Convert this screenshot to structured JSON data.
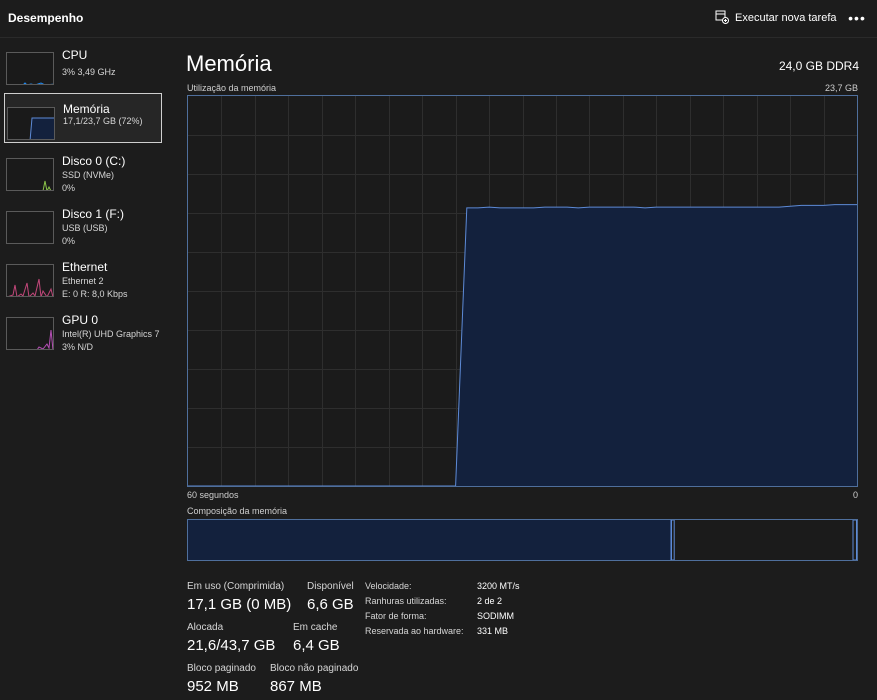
{
  "header": {
    "title": "Desempenho",
    "run_task_label": "Executar nova tarefa",
    "more_label": "•••"
  },
  "sidebar": {
    "items": [
      {
        "name": "CPU",
        "line1": "3% 3,49 GHz",
        "line2": "",
        "color": "#1e90ff",
        "selected": false
      },
      {
        "name": "Memória",
        "line1": "17,1/23,7 GB (72%)",
        "line2": "",
        "color": "#5d8ad6",
        "selected": true
      },
      {
        "name": "Disco 0 (C:)",
        "line1": "SSD (NVMe)",
        "line2": "0%",
        "color": "#8bc34a",
        "selected": false
      },
      {
        "name": "Disco 1 (F:)",
        "line1": "USB (USB)",
        "line2": "0%",
        "color": "#8bc34a",
        "selected": false
      },
      {
        "name": "Ethernet",
        "line1": "Ethernet 2",
        "line2": "E: 0 R: 8,0 Kbps",
        "color": "#c2477a",
        "selected": false
      },
      {
        "name": "GPU 0",
        "line1": "Intel(R) UHD Graphics 7",
        "line2": "3% N/D",
        "color": "#b64fb6",
        "selected": false
      }
    ]
  },
  "main": {
    "title": "Memória",
    "spec": "24,0 GB DDR4",
    "usage_label": "Utilização da memória",
    "max_label": "23,7 GB",
    "time_left": "60 segundos",
    "time_right": "0",
    "composition_label": "Composição da memória"
  },
  "usage_graph": {
    "max_gb": 23.7,
    "values_gb": [
      0,
      0,
      0,
      0,
      0,
      0,
      0,
      0,
      0,
      0,
      0,
      0,
      0,
      0,
      0,
      0,
      0,
      0,
      0,
      0,
      0,
      0,
      0,
      0,
      0,
      16.9,
      16.9,
      16.95,
      16.9,
      16.9,
      16.9,
      16.9,
      16.95,
      16.95,
      16.95,
      16.9,
      16.95,
      16.95,
      16.95,
      16.95,
      16.95,
      16.9,
      16.95,
      16.95,
      16.95,
      16.95,
      16.95,
      16.95,
      16.95,
      16.95,
      16.95,
      16.95,
      16.95,
      16.95,
      17.0,
      17.05,
      17.05,
      17.05,
      17.1,
      17.1,
      17.1
    ],
    "line_color": "#5d8ad6",
    "fill_color": "#13213d",
    "grid_color": "#2e2e2e"
  },
  "composition": {
    "in_use_fraction": 0.722,
    "modified_fraction": 0.004,
    "standby_fraction": 0.268,
    "free_fraction": 0.006
  },
  "stats": {
    "in_use_label": "Em uso (Comprimida)",
    "in_use_value": "17,1 GB (0 MB)",
    "available_label": "Disponível",
    "available_value": "6,6 GB",
    "committed_label": "Alocada",
    "committed_value": "21,6/43,7 GB",
    "cached_label": "Em cache",
    "cached_value": "6,4 GB",
    "paged_label": "Bloco paginado",
    "paged_value": "952 MB",
    "nonpaged_label": "Bloco não paginado",
    "nonpaged_value": "867 MB"
  },
  "info": {
    "speed_label": "Velocidade:",
    "speed_value": "3200 MT/s",
    "slots_label": "Ranhuras utilizadas:",
    "slots_value": "2 de 2",
    "form_label": "Fator de forma:",
    "form_value": "SODIMM",
    "reserved_label": "Reservada ao hardware:",
    "reserved_value": "331 MB"
  }
}
